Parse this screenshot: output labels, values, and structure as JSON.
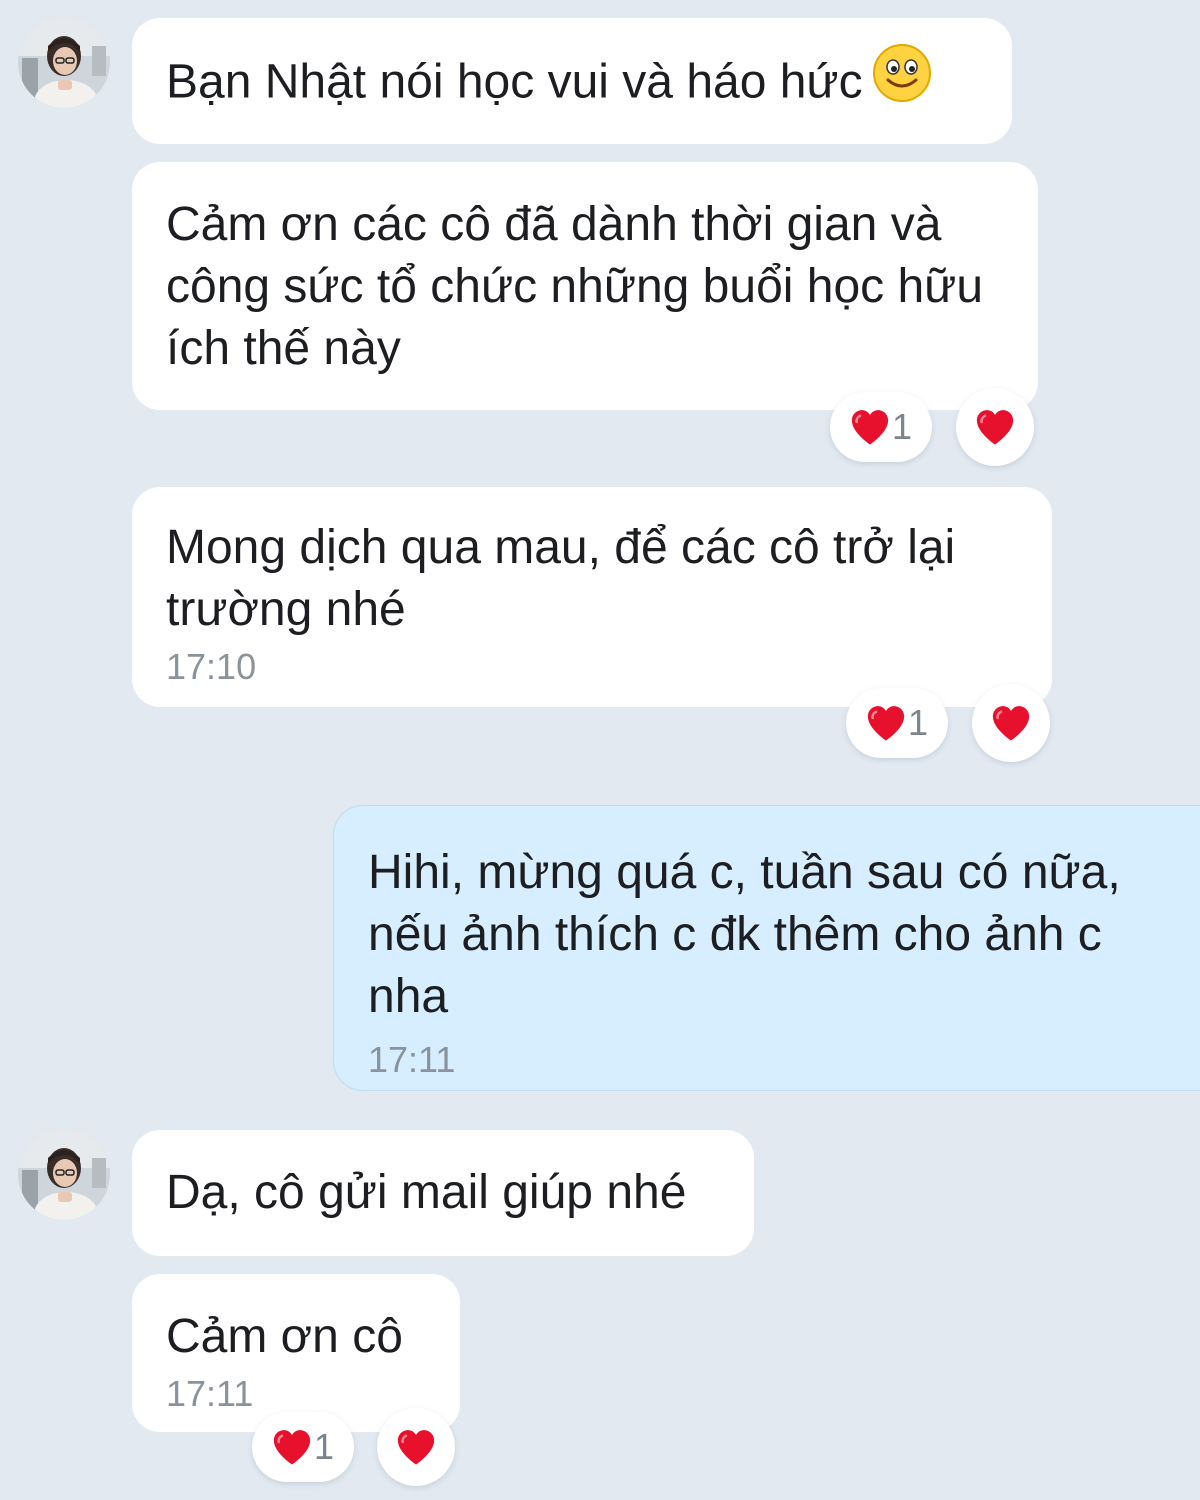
{
  "messages": [
    {
      "text": "Bạn Nhật nói học vui và háo hức",
      "emoji": "smile-emoji"
    },
    {
      "text": "Cảm ơn các cô đã dành thời gian và công sức tổ chức những buổi học hữu ích thế này",
      "reaction_count": "1"
    },
    {
      "text": "Mong dịch qua mau, để các cô trở lại trường nhé",
      "time": "17:10",
      "reaction_count": "1"
    },
    {
      "text": "Hihi, mừng quá c, tuần sau có nữa, nếu ảnh thích c đk thêm cho ảnh c nha",
      "time": "17:11"
    },
    {
      "text": "Dạ, cô gửi mail giúp nhé"
    },
    {
      "text": "Cảm ơn cô",
      "time": "17:11",
      "reaction_count": "1"
    }
  ],
  "colors": {
    "background": "#e2e9f1",
    "incoming_bubble": "#ffffff",
    "outgoing_bubble": "#d6eeff",
    "heart": "#e8112d"
  }
}
